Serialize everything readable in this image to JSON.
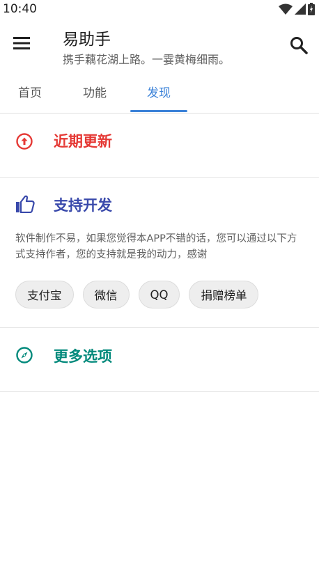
{
  "status_bar": {
    "time": "10:40"
  },
  "app_bar": {
    "title": "易助手",
    "subtitle": "携手藕花湖上路。一霎黄梅细雨。",
    "menu_icon": "menu-icon",
    "search_icon": "search-icon"
  },
  "tabs": [
    {
      "label": "首页",
      "active": false
    },
    {
      "label": "功能",
      "active": false
    },
    {
      "label": "发现",
      "active": true
    }
  ],
  "sections": {
    "updates": {
      "title": "近期更新",
      "icon": "arrow-up-circle-icon",
      "color": "#e53935"
    },
    "support": {
      "title": "支持开发",
      "icon": "thumb-up-icon",
      "color": "#3949ab",
      "description": "软件制作不易，如果您觉得本APP不错的话，您可以通过以下方式支持作者，您的支持就是我的动力，感谢",
      "options": [
        "支付宝",
        "微信",
        "QQ",
        "捐赠榜单"
      ]
    },
    "more": {
      "title": "更多选项",
      "icon": "compass-icon",
      "color": "#00897b"
    }
  },
  "colors": {
    "accent": "#3b82d8"
  }
}
